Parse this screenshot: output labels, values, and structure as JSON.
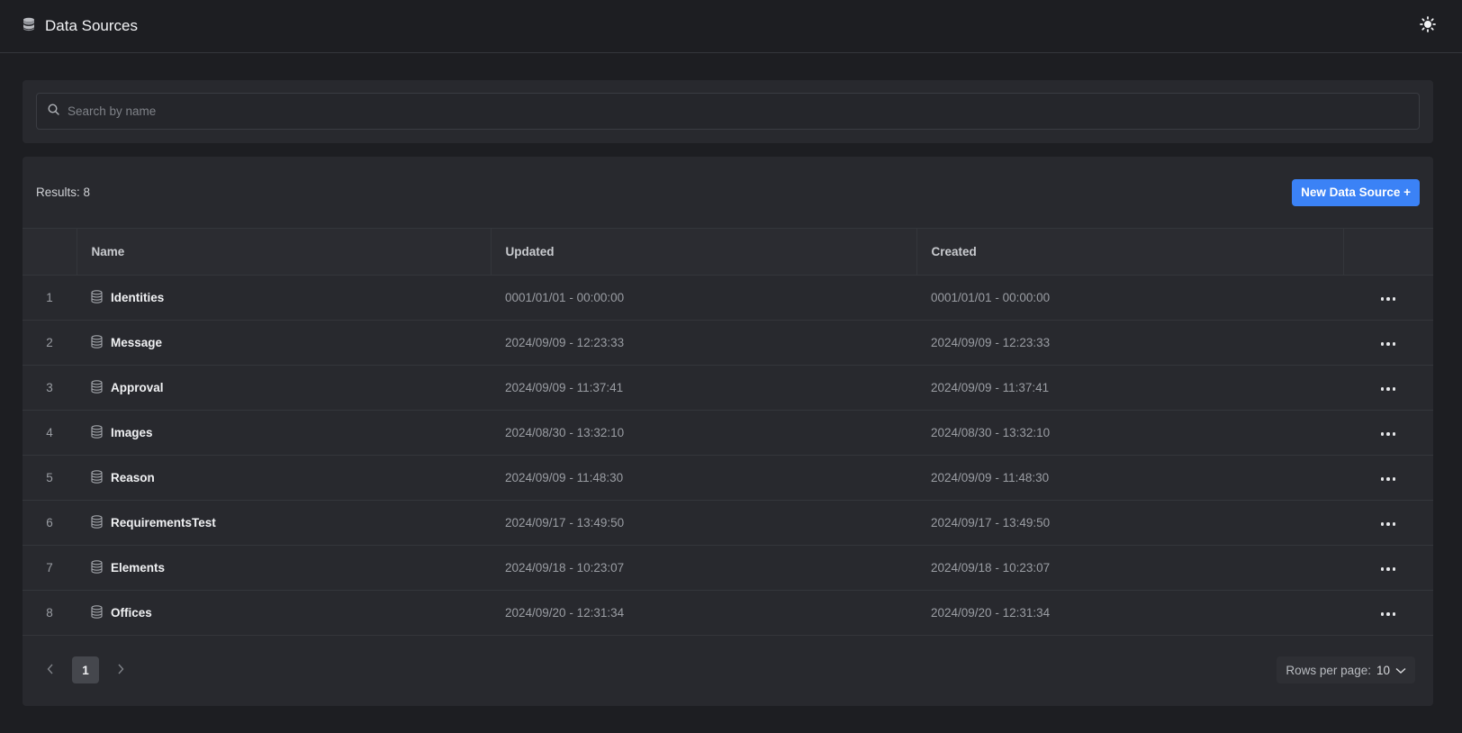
{
  "header": {
    "title": "Data Sources",
    "theme_icon": "sun-icon",
    "title_icon": "database-icon"
  },
  "search": {
    "placeholder": "Search by name",
    "value": ""
  },
  "toolbar": {
    "results_label": "Results: 8",
    "new_button_label": "New Data Source +"
  },
  "table": {
    "columns": [
      "Name",
      "Updated",
      "Created"
    ],
    "rows": [
      {
        "index": "1",
        "name": "Identities",
        "updated": "0001/01/01 - 00:00:00",
        "created": "0001/01/01 - 00:00:00"
      },
      {
        "index": "2",
        "name": "Message",
        "updated": "2024/09/09 - 12:23:33",
        "created": "2024/09/09 - 12:23:33"
      },
      {
        "index": "3",
        "name": "Approval",
        "updated": "2024/09/09 - 11:37:41",
        "created": "2024/09/09 - 11:37:41"
      },
      {
        "index": "4",
        "name": "Images",
        "updated": "2024/08/30 - 13:32:10",
        "created": "2024/08/30 - 13:32:10"
      },
      {
        "index": "5",
        "name": "Reason",
        "updated": "2024/09/09 - 11:48:30",
        "created": "2024/09/09 - 11:48:30"
      },
      {
        "index": "6",
        "name": "RequirementsTest",
        "updated": "2024/09/17 - 13:49:50",
        "created": "2024/09/17 - 13:49:50"
      },
      {
        "index": "7",
        "name": "Elements",
        "updated": "2024/09/18 - 10:23:07",
        "created": "2024/09/18 - 10:23:07"
      },
      {
        "index": "8",
        "name": "Offices",
        "updated": "2024/09/20 - 12:31:34",
        "created": "2024/09/20 - 12:31:34"
      }
    ]
  },
  "pagination": {
    "current_page": "1",
    "rows_per_page_label": "Rows per page:",
    "rows_per_page_value": "10"
  },
  "colors": {
    "accent": "#3b82f6",
    "background": "#1d1e22",
    "panel": "#28292e"
  }
}
